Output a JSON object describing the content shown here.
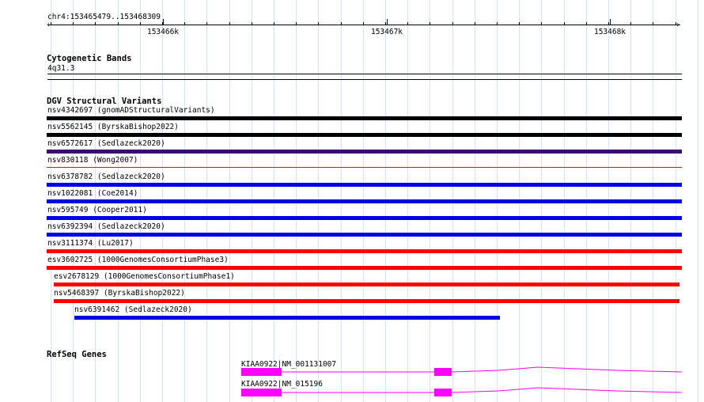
{
  "ruler": {
    "location": "chr4:153465479..153468309",
    "labels": [
      "153466k",
      "153467k",
      "153468k"
    ]
  },
  "cytobands": {
    "title": "Cytogenetic Bands",
    "band": "4q31.3"
  },
  "dgv": {
    "title": "DGV Structural Variants",
    "items": [
      {
        "label": "nsv4342697 (gnomADStructuralVariants)",
        "color": "#000000"
      },
      {
        "label": "nsv5562145 (ByrskaBishop2022)",
        "color": "#000000"
      },
      {
        "label": "nsv6572617 (Sedlazeck2020)",
        "color": "#3b0a6e"
      },
      {
        "label": "nsv830118 (Wong2007)",
        "color": "#ff0000"
      },
      {
        "label": "nsv6378782 (Sedlazeck2020)",
        "color": "#0000e0"
      },
      {
        "label": "nsv1022081 (Coe2014)",
        "color": "#0000e0"
      },
      {
        "label": "nsv595749 (Cooper2011)",
        "color": "#0000e0"
      },
      {
        "label": "nsv6392394 (Sedlazeck2020)",
        "color": "#0000e0"
      },
      {
        "label": "nsv3111374 (Lu2017)",
        "color": "#ff0000"
      },
      {
        "label": "esv3602725 (1000GenomesConsortiumPhase3)",
        "color": "#ff0000"
      },
      {
        "label": "esv2678129 (1000GenomesConsortiumPhase1)",
        "color": "#ff0000"
      },
      {
        "label": "nsv5468397 (ByrskaBishop2022)",
        "color": "#ff0000"
      },
      {
        "label": "nsv6391462 (Sedlazeck2020)",
        "color": "#0000e0"
      }
    ]
  },
  "refseq": {
    "title": "RefSeq Genes",
    "transcripts": [
      {
        "label": "KIAA0922|NM_001131007",
        "color": "#ff00ff"
      },
      {
        "label": "KIAA0922|NM_015196",
        "color": "#ff00ff"
      }
    ]
  }
}
